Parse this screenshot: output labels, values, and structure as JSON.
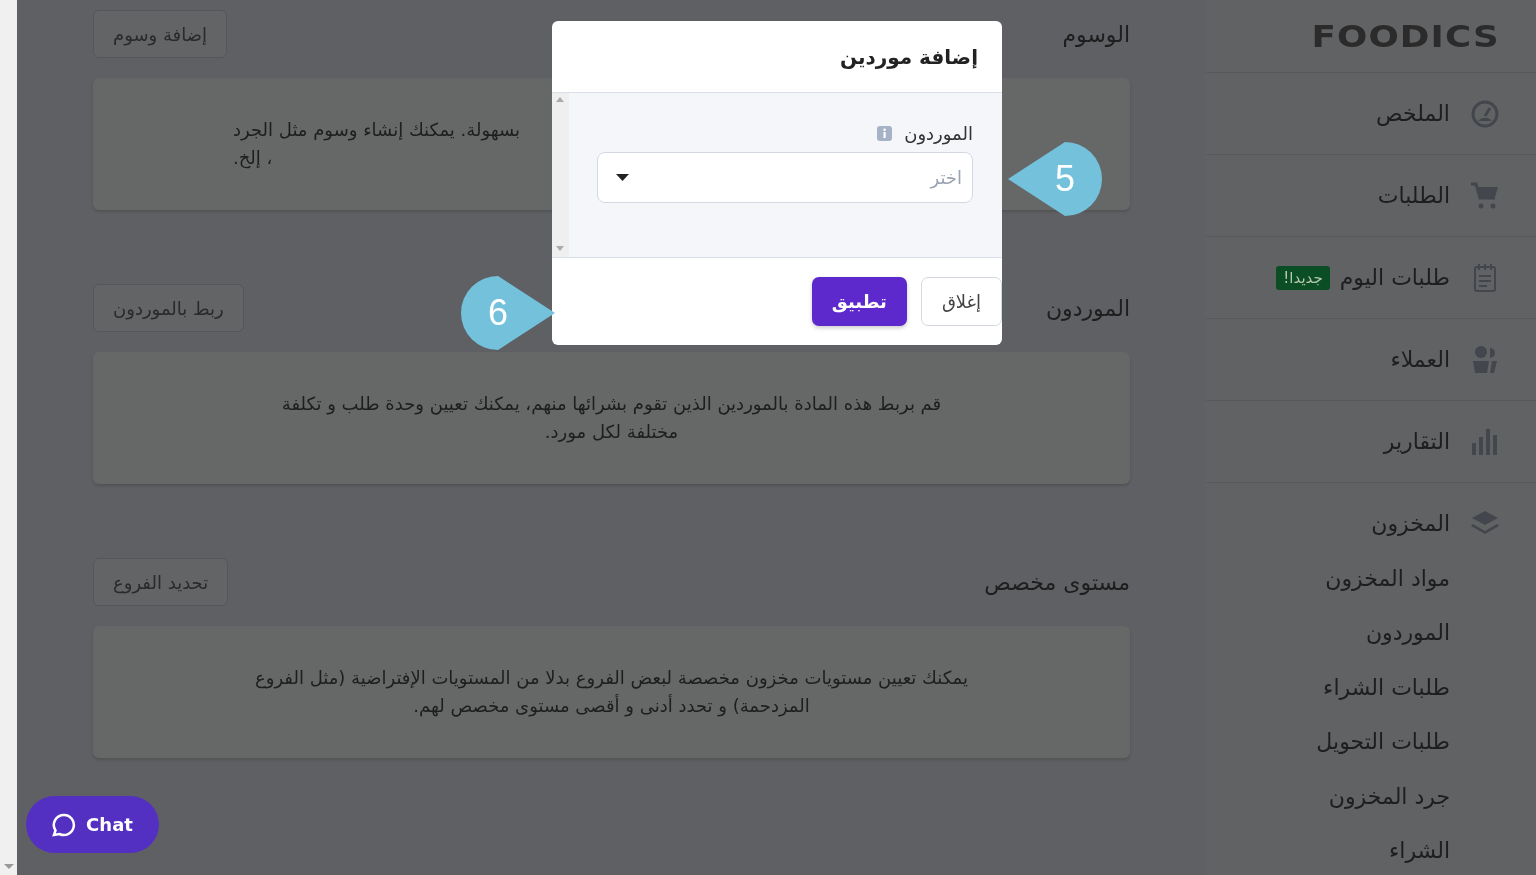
{
  "sidebar": {
    "logo": "FOODICS",
    "items": [
      {
        "label": "الملخص"
      },
      {
        "label": "الطلبات"
      },
      {
        "label": "طلبات اليوم",
        "badge": "جديدا!"
      },
      {
        "label": "العملاء"
      },
      {
        "label": "التقارير"
      },
      {
        "label": "المخزون",
        "expanded": true,
        "children": [
          {
            "label": "مواد المخزون"
          },
          {
            "label": "الموردون"
          },
          {
            "label": "طلبات الشراء"
          },
          {
            "label": "طلبات التحويل"
          },
          {
            "label": "جرد المخزون"
          },
          {
            "label": "الشراء"
          }
        ]
      }
    ]
  },
  "sections": [
    {
      "title": "الوسوم",
      "button": "إضافة وسوم",
      "lines": [
        "بسهولة. يمكنك إنشاء وسوم مثل الجرد",
        "، إلخ."
      ],
      "partial": true
    },
    {
      "title": "الموردون",
      "button": "ربط بالموردون",
      "lines": [
        "قم بربط هذه المادة بالموردين الذين تقوم بشرائها منهم، يمكنك تعيين وحدة طلب و تكلفة",
        "مختلفة لكل مورد."
      ]
    },
    {
      "title": "مستوى مخصص",
      "button": "تحديد الفروع",
      "lines": [
        "يمكنك تعيين مستويات مخزون مخصصة لبعض الفروع بدلا من المستويات الإفتراضية (مثل الفروع",
        "المزدحمة) و تحدد أدنى و أقصى مستوى مخصص لهم."
      ]
    }
  ],
  "modal": {
    "title": "إضافة موردين",
    "field": {
      "label": "الموردون",
      "placeholder": "اختر"
    },
    "buttons": [
      {
        "label": "إغلاق",
        "kind": "secondary"
      },
      {
        "label": "تطبيق",
        "kind": "primary"
      }
    ]
  },
  "callouts": [
    {
      "number": "5",
      "kind": "left"
    },
    {
      "number": "6",
      "kind": "right"
    }
  ],
  "chat": {
    "label": "Chat"
  }
}
